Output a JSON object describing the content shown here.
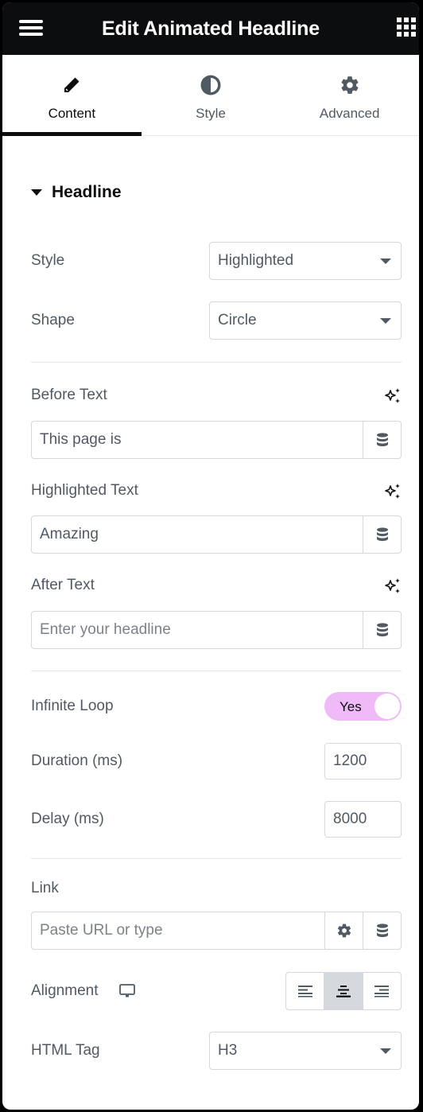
{
  "header": {
    "title": "Edit Animated Headline",
    "menu_icon": "hamburger-icon",
    "apps_icon": "grid-icon"
  },
  "tabs": [
    {
      "label": "Content",
      "icon": "pencil-icon",
      "active": true
    },
    {
      "label": "Style",
      "icon": "half-circle-icon",
      "active": false
    },
    {
      "label": "Advanced",
      "icon": "gear-icon",
      "active": false
    }
  ],
  "section": {
    "title": "Headline",
    "expanded": true
  },
  "fields": {
    "style": {
      "label": "Style",
      "value": "Highlighted"
    },
    "shape": {
      "label": "Shape",
      "value": "Circle"
    },
    "before_text": {
      "label": "Before Text",
      "value": "This page is",
      "placeholder": ""
    },
    "highlighted_text": {
      "label": "Highlighted Text",
      "value": "Amazing",
      "placeholder": ""
    },
    "after_text": {
      "label": "After Text",
      "value": "",
      "placeholder": "Enter your headline"
    },
    "infinite_loop": {
      "label": "Infinite Loop",
      "toggle_label": "Yes",
      "on": true
    },
    "duration": {
      "label": "Duration (ms)",
      "value": "1200"
    },
    "delay": {
      "label": "Delay (ms)",
      "value": "8000"
    },
    "link": {
      "label": "Link",
      "value": "",
      "placeholder": "Paste URL or type"
    },
    "alignment": {
      "label": "Alignment",
      "options": [
        "left",
        "center",
        "right"
      ],
      "selected": "center"
    },
    "html_tag": {
      "label": "HTML Tag",
      "value": "H3"
    }
  },
  "colors": {
    "header_bg": "#0c0d0e",
    "toggle_on": "#f0b9f8",
    "text": "#515962",
    "border": "#d5d8dc"
  }
}
